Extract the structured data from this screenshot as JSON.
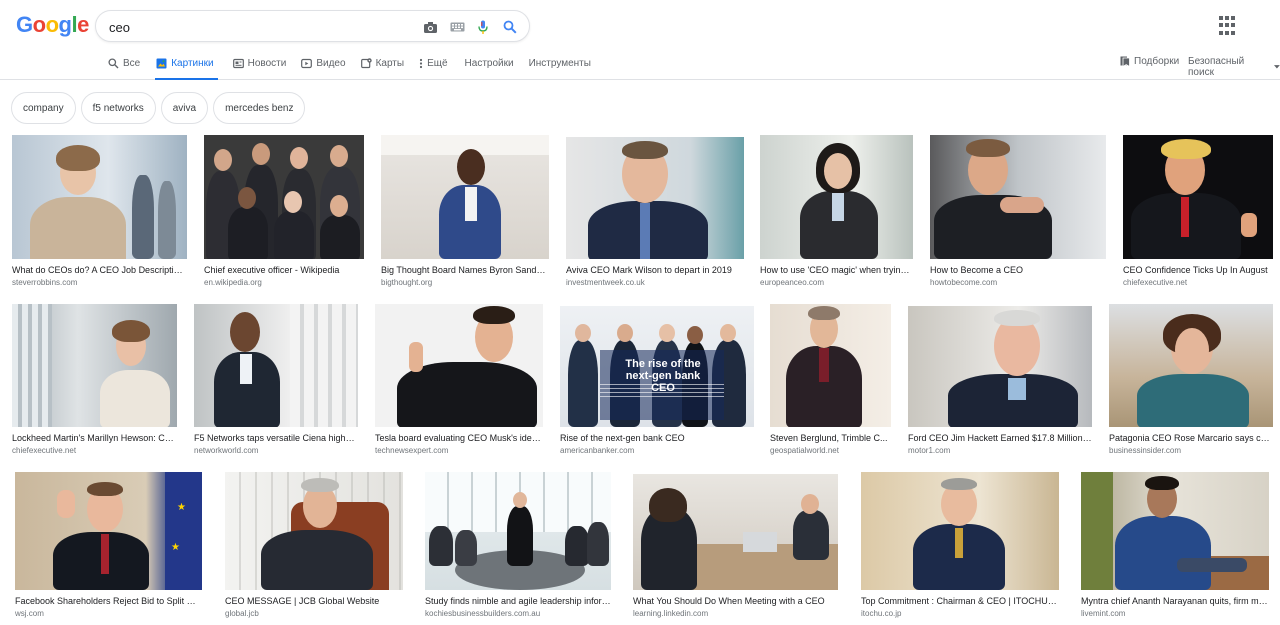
{
  "logo": "Google",
  "search": {
    "query": "ceo"
  },
  "tabs": [
    {
      "label": "Все",
      "icon": "search-icon"
    },
    {
      "label": "Картинки",
      "icon": "image-icon"
    },
    {
      "label": "Новости",
      "icon": "news-icon"
    },
    {
      "label": "Видео",
      "icon": "video-icon"
    },
    {
      "label": "Карты",
      "icon": "map-icon"
    },
    {
      "label": "Ещё",
      "icon": "more-vert-icon"
    },
    {
      "label": "Настройки"
    },
    {
      "label": "Инструменты"
    }
  ],
  "right_tools": {
    "collections": "Подборки",
    "safe_search": "Безопасный поиск"
  },
  "chips": [
    "company",
    "f5 networks",
    "aviva",
    "mercedes benz"
  ],
  "results": [
    {
      "caption": "What do CEOs do? A CEO Job Description ...",
      "source": "steverrobbins.com"
    },
    {
      "caption": "Chief executive officer - Wikipedia",
      "source": "en.wikipedia.org"
    },
    {
      "caption": "Big Thought Board Names Byron Sander ...",
      "source": "bigthought.org"
    },
    {
      "caption": "Aviva CEO Mark Wilson to depart in 2019",
      "source": "investmentweek.co.uk"
    },
    {
      "caption": "How to use 'CEO magic' when trying ...",
      "source": "europeanceo.com"
    },
    {
      "caption": "How to Become a CEO",
      "source": "howtobecome.com"
    },
    {
      "caption": "CEO Confidence Ticks Up In August",
      "source": "chiefexecutive.net"
    },
    {
      "caption": "Lockheed Martin's Marillyn Hewson: CE...",
      "source": "chiefexecutive.net"
    },
    {
      "caption": "F5 Networks taps versatile Ciena higher...",
      "source": "networkworld.com"
    },
    {
      "caption": "Tesla board evaluating CEO Musk's idea ...",
      "source": "technewsexpert.com"
    },
    {
      "caption": "Rise of the next-gen bank CEO",
      "source": "americanbanker.com",
      "banner": "The rise of the next-gen bank CEO"
    },
    {
      "caption": "Steven Berglund, Trimble C...",
      "source": "geospatialworld.net"
    },
    {
      "caption": "Ford CEO Jim Hackett Earned $17.8 Million ...",
      "source": "motor1.com"
    },
    {
      "caption": "Patagonia CEO Rose Marcario says ca...",
      "source": "businessinsider.com"
    },
    {
      "caption": "Facebook Shareholders Reject Bid to Split CEO...",
      "source": "wsj.com"
    },
    {
      "caption": "CEO MESSAGE | JCB Global Website",
      "source": "global.jcb"
    },
    {
      "caption": "Study finds nimble and agile leadership informs...",
      "source": "kochiesbusinessbuilders.com.au"
    },
    {
      "caption": "What You Should Do When Meeting with a CEO",
      "source": "learning.linkedin.com"
    },
    {
      "caption": "Top Commitment : Chairman & CEO | ITOCHU Cor...",
      "source": "itochu.co.jp"
    },
    {
      "caption": "Myntra chief Ananth Narayanan quits, firm may ...",
      "source": "livemint.com"
    }
  ],
  "colors": {
    "google_blue": "#4285f4",
    "google_red": "#ea4335",
    "google_yellow": "#fbbc05",
    "google_green": "#34a853",
    "active_tab": "#1a73e8"
  }
}
